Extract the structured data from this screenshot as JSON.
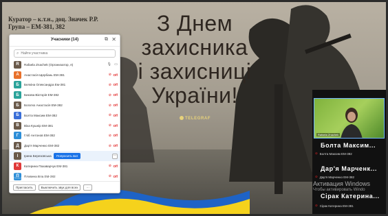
{
  "slide": {
    "curator_line1": "Куратор – к.т.н., доц. Значек Р.Р.",
    "curator_line2": "Група – ЕМ-381, 382",
    "headline": [
      "З Днем",
      "захисника",
      "і захисниці",
      "України!"
    ],
    "watermark": "TELEGRAF",
    "colors": {
      "flag_blue": "#1e63c6",
      "flag_yellow": "#f5d21c",
      "headline": "#2e2620"
    }
  },
  "participants_panel": {
    "title": "Учасники (14)",
    "search_placeholder": "Найти участника",
    "rows": [
      {
        "name": "Rafaela Znachek (Организатор, я)",
        "avatar": "R",
        "color": "photo",
        "mic": "on"
      },
      {
        "name": "Анастасія Щербань ЕМ-381",
        "avatar": "А",
        "color": "#e8712b",
        "mic": "off"
      },
      {
        "name": "Белкіна Олександра Ем-381",
        "avatar": "Б",
        "color": "#2aa39a",
        "mic": "off"
      },
      {
        "name": "Бикова Вікторія ЕМ-382",
        "avatar": "Б",
        "color": "#2aa39a",
        "mic": "off"
      },
      {
        "name": "Богатко Анастасія ЕМ-382",
        "avatar": "Б",
        "color": "photo",
        "mic": "off"
      },
      {
        "name": "Болта Максим ЕМ-382",
        "avatar": "Б",
        "color": "#3a6fd8",
        "mic": "off"
      },
      {
        "name": "Віка Кушнір ЕМ-381",
        "avatar": "В",
        "color": "photo",
        "mic": "off"
      },
      {
        "name": "Гліб Антонов ЕМ-382",
        "avatar": "Г",
        "color": "#2d8ed8",
        "mic": "off"
      },
      {
        "name": "Дар'я Марченко ЕМ-382",
        "avatar": "Д",
        "color": "photo",
        "mic": "off"
      },
      {
        "name": "Ірина Березовська",
        "avatar": "І",
        "color": "photo",
        "mic": "none"
      },
      {
        "name": "Катерина Пахаварчук ЕМ-381",
        "avatar": "К",
        "color": "#e03a3a",
        "mic": "off"
      },
      {
        "name": "Плавина Вла ЕМ-382",
        "avatar": "П",
        "color": "#2d8ed8",
        "mic": "off"
      }
    ],
    "invite_label": "Попросить вкл",
    "more_label": "···",
    "footer": {
      "invite": "Пригласить",
      "mute_all": "Выключить звук для всех",
      "more": "···"
    },
    "mic_off_glyph": "🎤̸",
    "cam_off_label": "Off"
  },
  "right_panel": {
    "video_name": "Rafaela Znachek",
    "speakers": [
      {
        "big": "Болта Максим...",
        "small": "Болта Максим ЕМ-382"
      },
      {
        "big": "Дар'я Марченк...",
        "small": "Дар'я Марченко ЕМ-382"
      },
      {
        "big": "Сірак Катерина...",
        "small": "Сірак Катерина ЕМ-381"
      }
    ]
  },
  "os_overlay": {
    "activation_left": "Активация Windows",
    "activation_left_sub": "Чтобы активировать Windows, перейдите в",
    "activation_right": "Активация Windows",
    "activation_right_sub": "Чтобы активировать Windo"
  }
}
